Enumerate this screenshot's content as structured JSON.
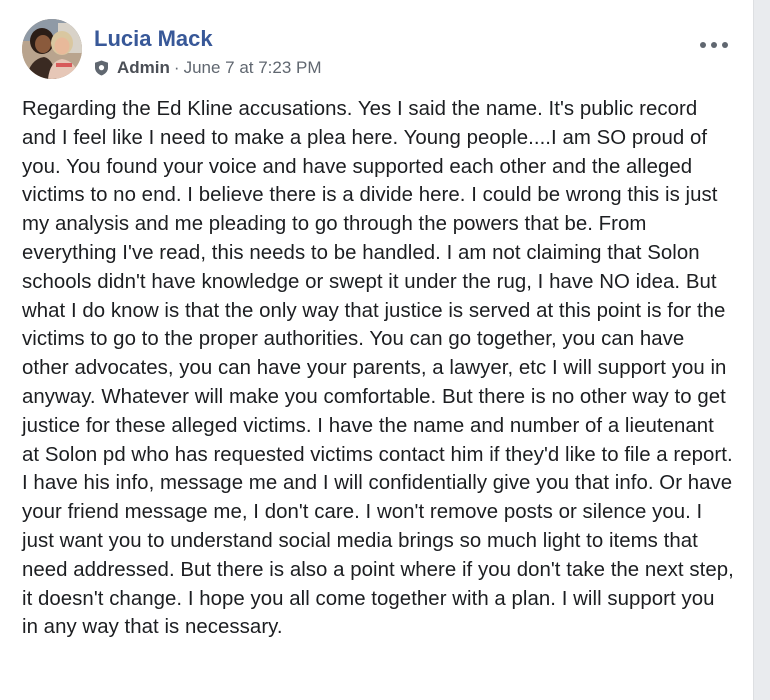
{
  "post": {
    "author": {
      "name": "Lucia Mack",
      "avatar_icon": "profile-photo"
    },
    "meta": {
      "role_icon": "shield-icon",
      "role": "Admin",
      "separator": "·",
      "timestamp": "June 7 at 7:23 PM"
    },
    "options_icon": "more-options-icon",
    "text": "Regarding the Ed Kline accusations. Yes I said the name. It's public record and I feel like I need to make a plea here. Young people....I am SO proud of you. You found your voice and have supported each other and the alleged victims to no end. I believe there is a divide here. I could be wrong this is just my analysis and me pleading to go through the powers that be. From everything I've read, this needs to be handled. I am not claiming that Solon schools didn't have knowledge or swept it under the rug, I have NO idea. But what I do know is that the only way that justice is served at this point is for the victims to go to the proper authorities. You can go together, you can have other advocates, you can have your parents, a lawyer, etc I will support you in anyway. Whatever will make you comfortable. But there is no other way to get justice for these alleged victims. I have the name and number of a lieutenant at Solon pd who has requested victims contact him if they'd like to file a report. I have his info, message me and I will confidentially give you that info. Or have your friend message me, I don't care. I won't remove posts or silence you. I just want you to understand social media brings so much light to items that need addressed. But there is also a point where if you don't take the next step, it doesn't change. I hope you all come together with a plan. I will support you in any way that is necessary."
  },
  "colors": {
    "author_name": "#385898",
    "meta_text": "#606770",
    "body_text": "#1c1e21",
    "card_bg": "#ffffff",
    "page_bg": "#e9ebee"
  }
}
